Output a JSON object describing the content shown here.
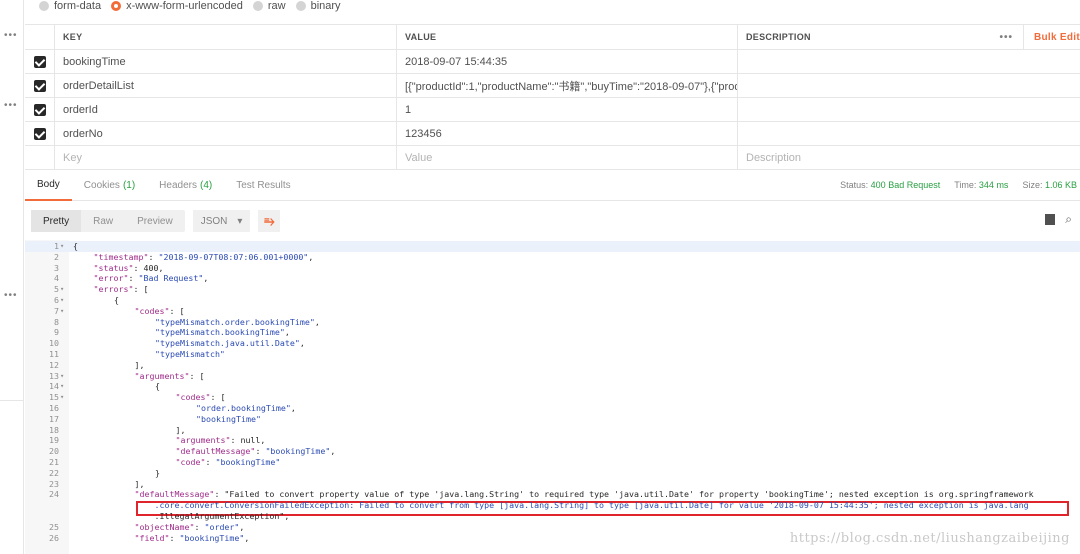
{
  "body_types": [
    {
      "label": "form-data",
      "selected": false
    },
    {
      "label": "x-www-form-urlencoded",
      "selected": true
    },
    {
      "label": "raw",
      "selected": false
    },
    {
      "label": "binary",
      "selected": false
    }
  ],
  "table": {
    "headers": {
      "key": "KEY",
      "value": "VALUE",
      "description": "DESCRIPTION",
      "more": "•••",
      "bulk_edit": "Bulk Edit"
    },
    "rows": [
      {
        "checked": true,
        "key": "bookingTime",
        "value": "2018-09-07 15:44:35",
        "description": ""
      },
      {
        "checked": true,
        "key": "orderDetailList",
        "value": "[{\"productId\":1,\"productName\":\"书籍\",\"buyTime\":\"2018-09-07\"},{\"produc...",
        "description": ""
      },
      {
        "checked": true,
        "key": "orderId",
        "value": "1",
        "description": ""
      },
      {
        "checked": true,
        "key": "orderNo",
        "value": "123456",
        "description": ""
      }
    ],
    "placeholder": {
      "key": "Key",
      "value": "Value",
      "description": "Description"
    }
  },
  "response_tabs": [
    {
      "label": "Body",
      "count": "",
      "active": true
    },
    {
      "label": "Cookies",
      "count": "(1)",
      "active": false
    },
    {
      "label": "Headers",
      "count": "(4)",
      "active": false
    },
    {
      "label": "Test Results",
      "count": "",
      "active": false
    }
  ],
  "status": {
    "status_label": "Status:",
    "status_value": "400 Bad Request",
    "time_label": "Time:",
    "time_value": "344 ms",
    "size_label": "Size:",
    "size_value": "1.06 KB"
  },
  "format_tabs": [
    {
      "label": "Pretty",
      "active": true
    },
    {
      "label": "Raw",
      "active": false
    },
    {
      "label": "Preview",
      "active": false
    }
  ],
  "format_select": {
    "value": "JSON",
    "icon": "chevron-down-icon"
  },
  "sidebar_more": "•••",
  "code_lines": [
    {
      "n": "1",
      "fold": "▾",
      "indent": 0,
      "text": "{"
    },
    {
      "n": "2",
      "fold": "",
      "indent": 1,
      "text": "\"timestamp\": \"2018-09-07T08:07:06.001+0000\","
    },
    {
      "n": "3",
      "fold": "",
      "indent": 1,
      "text": "\"status\": 400,"
    },
    {
      "n": "4",
      "fold": "",
      "indent": 1,
      "text": "\"error\": \"Bad Request\","
    },
    {
      "n": "5",
      "fold": "▾",
      "indent": 1,
      "text": "\"errors\": ["
    },
    {
      "n": "6",
      "fold": "▾",
      "indent": 2,
      "text": "{"
    },
    {
      "n": "7",
      "fold": "▾",
      "indent": 3,
      "text": "\"codes\": ["
    },
    {
      "n": "8",
      "fold": "",
      "indent": 4,
      "text": "\"typeMismatch.order.bookingTime\","
    },
    {
      "n": "9",
      "fold": "",
      "indent": 4,
      "text": "\"typeMismatch.bookingTime\","
    },
    {
      "n": "10",
      "fold": "",
      "indent": 4,
      "text": "\"typeMismatch.java.util.Date\","
    },
    {
      "n": "11",
      "fold": "",
      "indent": 4,
      "text": "\"typeMismatch\""
    },
    {
      "n": "12",
      "fold": "",
      "indent": 3,
      "text": "],"
    },
    {
      "n": "13",
      "fold": "▾",
      "indent": 3,
      "text": "\"arguments\": ["
    },
    {
      "n": "14",
      "fold": "▾",
      "indent": 4,
      "text": "{"
    },
    {
      "n": "15",
      "fold": "▾",
      "indent": 5,
      "text": "\"codes\": ["
    },
    {
      "n": "16",
      "fold": "",
      "indent": 6,
      "text": "\"order.bookingTime\","
    },
    {
      "n": "17",
      "fold": "",
      "indent": 6,
      "text": "\"bookingTime\""
    },
    {
      "n": "18",
      "fold": "",
      "indent": 5,
      "text": "],"
    },
    {
      "n": "19",
      "fold": "",
      "indent": 5,
      "text": "\"arguments\": null,"
    },
    {
      "n": "20",
      "fold": "",
      "indent": 5,
      "text": "\"defaultMessage\": \"bookingTime\","
    },
    {
      "n": "21",
      "fold": "",
      "indent": 5,
      "text": "\"code\": \"bookingTime\""
    },
    {
      "n": "22",
      "fold": "",
      "indent": 4,
      "text": "}"
    },
    {
      "n": "23",
      "fold": "",
      "indent": 3,
      "text": "],"
    },
    {
      "n": "24",
      "fold": "",
      "indent": 3,
      "text": "\"defaultMessage\": \"Failed to convert property value of type 'java.lang.String' to required type 'java.util.Date' for property 'bookingTime'; nested exception is org.springframework"
    },
    {
      "n": "",
      "fold": "",
      "indent": 3,
      "text": "    .core.convert.ConversionFailedException: Failed to convert from type [java.lang.String] to type [java.util.Date] for value '2018-09-07 15:44:35'; nested exception is java.lang"
    },
    {
      "n": "",
      "fold": "",
      "indent": 3,
      "text": "    .IllegalArgumentException\","
    },
    {
      "n": "25",
      "fold": "",
      "indent": 3,
      "text": "\"objectName\": \"order\","
    },
    {
      "n": "26",
      "fold": "",
      "indent": 3,
      "text": "\"field\": \"bookingTime\","
    }
  ],
  "watermark": "https://blog.csdn.net/liushangzaibeijing",
  "colors": {
    "accent": "#f26b3a",
    "status_ok": "#2aa043",
    "highlight_box": "#e0242b"
  }
}
